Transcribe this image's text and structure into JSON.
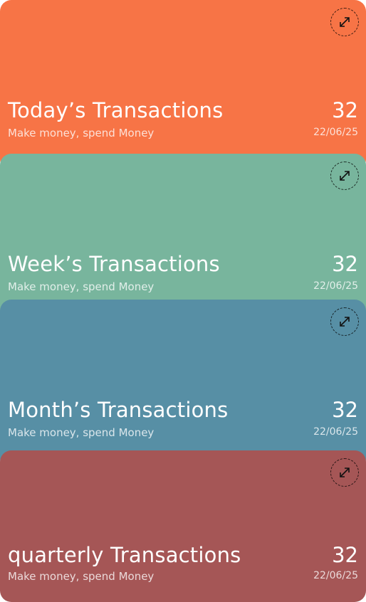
{
  "cards": [
    {
      "title": "Today’s Transactions",
      "subtitle": "Make money, spend Money",
      "count": "32",
      "date": "22/06/25",
      "color": "#F77446",
      "icon": "expand-icon"
    },
    {
      "title": "Week’s Transactions",
      "subtitle": "Make money, spend Money",
      "count": "32",
      "date": "22/06/25",
      "color": "#78B59D",
      "icon": "expand-icon"
    },
    {
      "title": "Month’s Transactions",
      "subtitle": "Make money, spend Money",
      "count": "32",
      "date": "22/06/25",
      "color": "#578FA5",
      "icon": "expand-icon"
    },
    {
      "title": "quarterly Transactions",
      "subtitle": "Make money, spend Money",
      "count": "32",
      "date": "22/06/25",
      "color": "#A55656",
      "icon": "expand-icon"
    }
  ]
}
